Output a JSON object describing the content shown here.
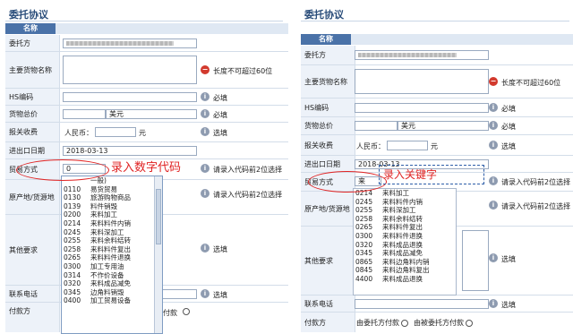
{
  "left": {
    "title": "委托协议",
    "header": "名称",
    "rows": {
      "principal": "委托方",
      "goods_name": "主要货物名称",
      "hs_code": "HS编码",
      "total_price": "货物总价",
      "customs_fee": "报关收费",
      "io_date": "进出口日期",
      "trade_mode": "贸易方式",
      "origin": "原产地/货源地",
      "other_req": "其他要求",
      "contact": "联系电话",
      "payer": "付款方"
    },
    "warn_text": "长度不可超过60位",
    "required": "必填",
    "optional": "选填",
    "currency": "美元",
    "rmb_label": "人民币：",
    "yuan": "元",
    "date_value": "2018-03-13",
    "trade_input": "0",
    "trade_hint": "请录入代码前2位选择",
    "origin_hint": "请录入代码前2位选择",
    "annotation": "录入数字代码",
    "payer_suffix": "付款",
    "dropdown": [
      {
        "code": "",
        "name": "一般)"
      },
      {
        "code": "0110",
        "name": "易货贸易"
      },
      {
        "code": "0130",
        "name": "旅游购物商品"
      },
      {
        "code": "0139",
        "name": "料件销毁"
      },
      {
        "code": "0200",
        "name": "来料加工"
      },
      {
        "code": "0214",
        "name": "来料料件内销"
      },
      {
        "code": "0245",
        "name": "来料深加工"
      },
      {
        "code": "0255",
        "name": "来料余料结转"
      },
      {
        "code": "0258",
        "name": "来料料件复出"
      },
      {
        "code": "0265",
        "name": "来料料件退换"
      },
      {
        "code": "0300",
        "name": "加工专用油"
      },
      {
        "code": "0314",
        "name": "不作价设备"
      },
      {
        "code": "0320",
        "name": "来料成品减免"
      },
      {
        "code": "0345",
        "name": "边角料销毁"
      },
      {
        "code": "0400",
        "name": "加工贸易设备"
      }
    ]
  },
  "right": {
    "title": "委托协议",
    "header": "名称",
    "rows": {
      "principal": "委托方",
      "goods_name": "主要货物名称",
      "hs_code": "HS编码",
      "total_price": "货物总价",
      "customs_fee": "报关收费",
      "io_date": "进出口日期",
      "trade_mode": "贸易方式",
      "origin": "原产地/货源地",
      "other_req": "其他要求",
      "contact": "联系电话",
      "payer": "付款方"
    },
    "warn_text": "长度不可超过60位",
    "required": "必填",
    "optional": "选填",
    "currency": "美元",
    "rmb_label": "人民币：",
    "yuan": "元",
    "date_value": "2018-03-13",
    "trade_input": "来",
    "trade_hint": "请录入代码前2位选择",
    "origin_hint": "请录入代码前2位选择",
    "annotation": "录入关键字",
    "payer_opt1": "由委托方付款",
    "payer_opt2": "由被委托方付款",
    "dropdown": [
      {
        "code": "0214",
        "name": "来料加工"
      },
      {
        "code": "0245",
        "name": "来料料件内销"
      },
      {
        "code": "0255",
        "name": "来料深加工"
      },
      {
        "code": "0258",
        "name": "来料余料结转"
      },
      {
        "code": "0265",
        "name": "来料料件复出"
      },
      {
        "code": "0300",
        "name": "来料料件退换"
      },
      {
        "code": "0320",
        "name": "来料成品退换"
      },
      {
        "code": "0345",
        "name": "来料成品减免"
      },
      {
        "code": "0865",
        "name": "来料边角料内销"
      },
      {
        "code": "0845",
        "name": "来料边角料复出"
      },
      {
        "code": "4400",
        "name": "来料成品退换"
      }
    ]
  }
}
